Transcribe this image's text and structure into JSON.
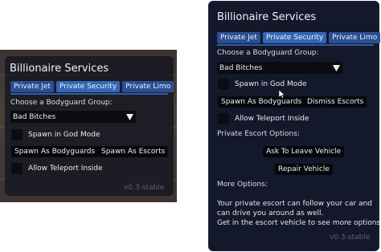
{
  "menu": {
    "title": "Billionaire Services",
    "tabs": [
      "Private Jet",
      "Private Security",
      "Private Limo"
    ],
    "active_tab_index": 1,
    "group_label": "Choose a Bodyguard Group:",
    "group_value": "Bad Bitches",
    "god_mode_label": "Spawn in God Mode",
    "spawn_bodyguards_label": "Spawn As Bodyguards",
    "teleport_label": "Allow Teleport Inside",
    "version": "v0.3-stable"
  },
  "left_panel": {
    "spawn_escorts_label": "Spawn As Escorts"
  },
  "right_panel": {
    "dismiss_label": "Dismiss Escorts",
    "escort_options_label": "Private Escort Options:",
    "ask_leave_label": "Ask To Leave Vehicle",
    "repair_label": "Repair Vehicle",
    "more_options_label": "More Options:",
    "info_lines": [
      "Your private escort can follow your car and",
      "can drive you around as well.",
      "Get in the escort vehicle to see more options."
    ]
  },
  "colors": {
    "tab": "#2b4f93",
    "tab_active": "#3466b5",
    "panel_right_bg": "#13182a"
  }
}
